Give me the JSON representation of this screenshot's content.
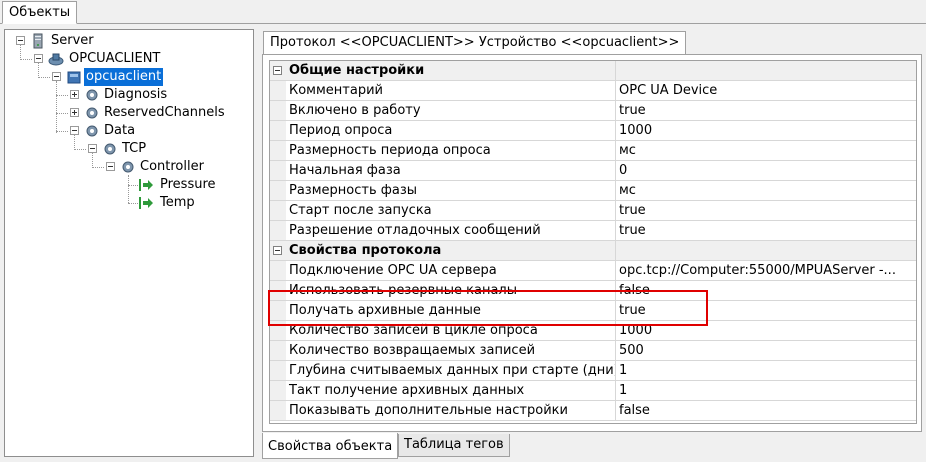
{
  "top_tab": {
    "label": "Объекты"
  },
  "tree": {
    "server": "Server",
    "opcuaclient_proto": "OPCUACLIENT",
    "opcuaclient_dev": "opcuaclient",
    "diagnosis": "Diagnosis",
    "reserved": "ReservedChannels",
    "data": "Data",
    "tcp": "TCP",
    "controller": "Controller",
    "pressure": "Pressure",
    "temp": "Temp"
  },
  "right_tab": {
    "label": "Протокол <<OPCUACLIENT>> Устройство <<opcuaclient>>"
  },
  "categories": {
    "general": "Общие настройки",
    "protocol": "Свойства протокола"
  },
  "general_rows": [
    {
      "name": "Комментарий",
      "value": "OPC UA Device"
    },
    {
      "name": "Включено в работу",
      "value": "true"
    },
    {
      "name": "Период опроса",
      "value": "1000"
    },
    {
      "name": "Размерность периода опроса",
      "value": "мс"
    },
    {
      "name": "Начальная фаза",
      "value": "0"
    },
    {
      "name": "Размерность фазы",
      "value": "мс"
    },
    {
      "name": "Старт после запуска",
      "value": "true"
    },
    {
      "name": "Разрешение отладочных сообщений",
      "value": "true"
    }
  ],
  "protocol_rows": [
    {
      "name": "Подключение OPC UA сервера",
      "value": "opc.tcp://Computer:55000/MPUAServer -..."
    },
    {
      "name": "Использовать резервные каналы",
      "value": "false"
    },
    {
      "name": "Получать архивные данные",
      "value": "true"
    },
    {
      "name": "Количество записей в цикле опроса",
      "value": "1000"
    },
    {
      "name": "Количество возвращаемых записей",
      "value": "500"
    },
    {
      "name": "Глубина считываемых данных при старте (дни)",
      "value": "1"
    },
    {
      "name": "Такт получение архивных данных",
      "value": "1"
    },
    {
      "name": "Показывать дополнительные настройки",
      "value": "false"
    }
  ],
  "bottom_tabs": {
    "properties": "Свойства объекта",
    "tags": "Таблица тегов"
  },
  "colors": {
    "selection": "#0a6fd8",
    "highlight": "#e00000",
    "arrow": "#2e9a3a"
  }
}
